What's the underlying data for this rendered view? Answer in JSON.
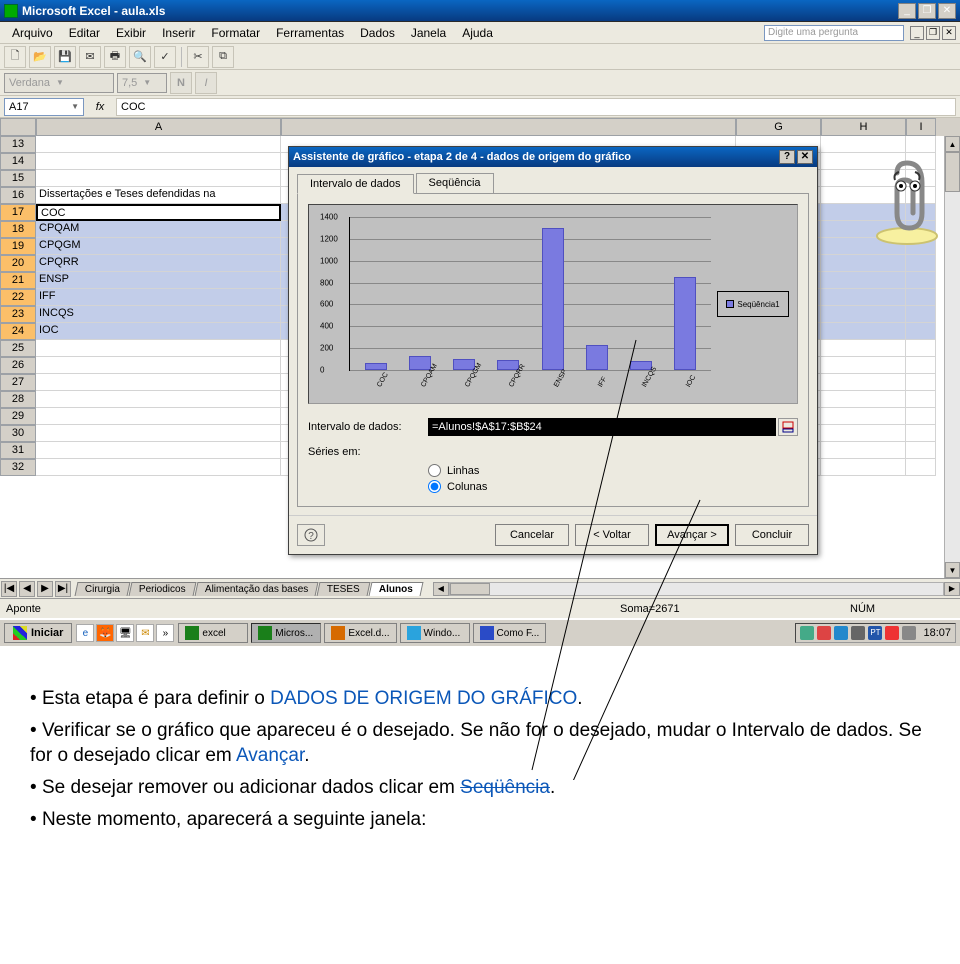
{
  "window": {
    "app_title": "Microsoft Excel - aula.xls"
  },
  "menu": [
    "Arquivo",
    "Editar",
    "Exibir",
    "Inserir",
    "Formatar",
    "Ferramentas",
    "Dados",
    "Janela",
    "Ajuda"
  ],
  "question_box_placeholder": "Digite uma pergunta",
  "font_toolbar": {
    "font_name": "Verdana",
    "font_size": "7,5"
  },
  "formula_bar": {
    "name_box": "A17",
    "fx_label": "fx",
    "formula_value": "COC"
  },
  "columns": [
    "A",
    "G",
    "H",
    "I"
  ],
  "rows": [
    {
      "num": "13",
      "A": ""
    },
    {
      "num": "14",
      "A": ""
    },
    {
      "num": "15",
      "A": ""
    },
    {
      "num": "16",
      "A": "Dissertações e Teses defendidas na"
    },
    {
      "num": "17",
      "A": "COC"
    },
    {
      "num": "18",
      "A": "CPQAM"
    },
    {
      "num": "19",
      "A": "CPQGM"
    },
    {
      "num": "20",
      "A": "CPQRR"
    },
    {
      "num": "21",
      "A": "ENSP"
    },
    {
      "num": "22",
      "A": "IFF"
    },
    {
      "num": "23",
      "A": "INCQS"
    },
    {
      "num": "24",
      "A": "IOC"
    },
    {
      "num": "25",
      "A": ""
    },
    {
      "num": "26",
      "A": ""
    },
    {
      "num": "27",
      "A": ""
    },
    {
      "num": "28",
      "A": ""
    },
    {
      "num": "29",
      "A": ""
    },
    {
      "num": "30",
      "A": ""
    },
    {
      "num": "31",
      "A": ""
    },
    {
      "num": "32",
      "A": ""
    }
  ],
  "sheet_tabs": [
    "Cirurgia",
    "Periodicos",
    "Alimentação das bases",
    "TESES",
    "Alunos"
  ],
  "active_tab": "Alunos",
  "statusbar": {
    "ready": "Aponte",
    "sum_label": "Soma=2671",
    "num_label": "NÚM"
  },
  "taskbar": {
    "start": "Iniciar",
    "tasks": [
      {
        "label": "excel",
        "icon_color": "#1a7f1a"
      },
      {
        "label": "Micros...",
        "icon_color": "#1a7f1a",
        "active": true
      },
      {
        "label": "Excel.d...",
        "icon_color": "#d66a00"
      },
      {
        "label": "Windo...",
        "icon_color": "#2aa3dd"
      },
      {
        "label": "Como F...",
        "icon_color": "#2a4bc7"
      }
    ],
    "lang": "PT",
    "clock": "18:07"
  },
  "wizard": {
    "title": "Assistente de gráfico - etapa 2 de 4 - dados de origem do gráfico",
    "tabs": [
      "Intervalo de dados",
      "Seqüência"
    ],
    "active_tab": 0,
    "data_range_label": "Intervalo de dados:",
    "data_range_value": "=Alunos!$A$17:$B$24",
    "series_in_label": "Séries em:",
    "radio_rows": "Linhas",
    "radio_cols": "Colunas",
    "radio_selected": "Colunas",
    "legend_label": "Seqüência1",
    "buttons": {
      "cancel": "Cancelar",
      "back": "< Voltar",
      "next": "Avançar >",
      "finish": "Concluir"
    }
  },
  "chart_data": {
    "type": "bar",
    "categories": [
      "COC",
      "CPQAM",
      "CPQGM",
      "CPQRR",
      "ENSP",
      "IFF",
      "INCQS",
      "IOC"
    ],
    "values": [
      60,
      130,
      100,
      90,
      1300,
      230,
      80,
      850
    ],
    "title": "",
    "xlabel": "",
    "ylabel": "",
    "ylim": [
      0,
      1400
    ],
    "yticks": [
      0,
      200,
      400,
      600,
      800,
      1000,
      1200,
      1400
    ],
    "legend": [
      "Seqüência1"
    ]
  },
  "instructions": {
    "line1_a": "Esta etapa é para definir o ",
    "line1_b": "DADOS DE ORIGEM DO GRÁFICO",
    "line1_c": ".",
    "line2_a": "Verificar se o gráfico que apareceu é o desejado. Se não for o desejado, mudar o Intervalo de dados. Se for o desejado clicar em ",
    "line2_b": "Avançar",
    "line2_c": ".",
    "line3_a": "Se desejar remover ou adicionar dados clicar em ",
    "line3_b": "Seqüência",
    "line3_c": ".",
    "line4": "Neste momento, aparecerá a seguinte janela:"
  }
}
